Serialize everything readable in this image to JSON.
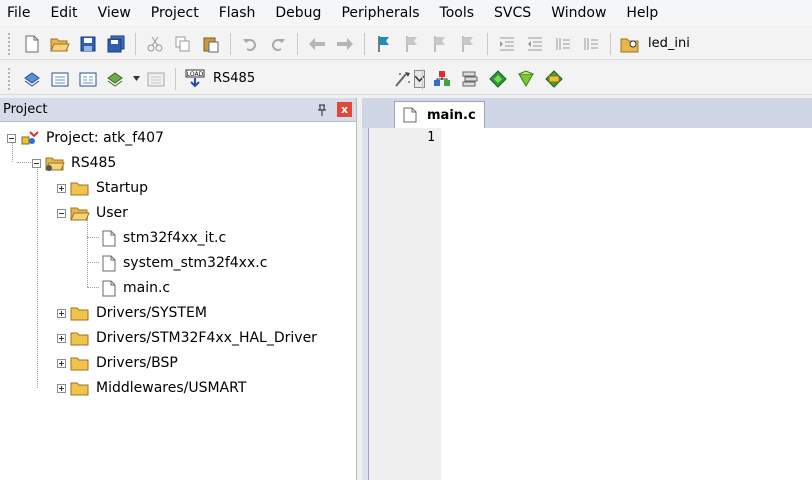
{
  "menu": [
    "File",
    "Edit",
    "View",
    "Project",
    "Flash",
    "Debug",
    "Peripherals",
    "Tools",
    "SVCS",
    "Window",
    "Help"
  ],
  "toolbar1": {
    "search_text": "led_ini"
  },
  "toolbar2": {
    "target": "RS485"
  },
  "project_panel": {
    "title": "Project",
    "pin_icon": "pin-icon",
    "close_label": "x",
    "tree": {
      "project": "Project: atk_f407",
      "target": "RS485",
      "groups": [
        "Startup",
        "User",
        "Drivers/SYSTEM",
        "Drivers/STM32F4xx_HAL_Driver",
        "Drivers/BSP",
        "Middlewares/USMART"
      ],
      "user_files": [
        "stm32f4xx_it.c",
        "system_stm32f4xx.c",
        "main.c"
      ]
    }
  },
  "editor": {
    "tab": "main.c",
    "line_numbers": [
      "1"
    ]
  }
}
